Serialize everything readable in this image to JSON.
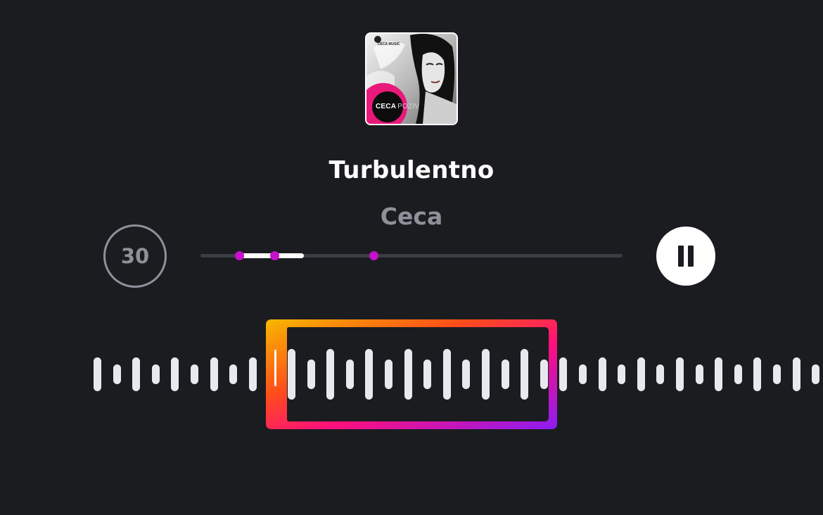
{
  "album": {
    "cover_text_main": "CECA",
    "cover_text_sub": "POZIV",
    "cover_label_top": "CECA MUSIC"
  },
  "track": {
    "title": "Turbulentno",
    "artist": "Ceca"
  },
  "controls": {
    "skip_label": "30",
    "skip_icon": "skip-30-icon",
    "pause_icon": "pause-icon"
  },
  "progress": {
    "played_start_fraction": 0.093,
    "played_end_fraction": 0.245,
    "markers": [
      0.093,
      0.175,
      0.411
    ]
  },
  "colors": {
    "background": "#1b1c20",
    "accent_marker": "#c511c9",
    "gradient": [
      "#f6b800",
      "#ff6a00",
      "#ff0f7b",
      "#8b1cf6"
    ]
  }
}
